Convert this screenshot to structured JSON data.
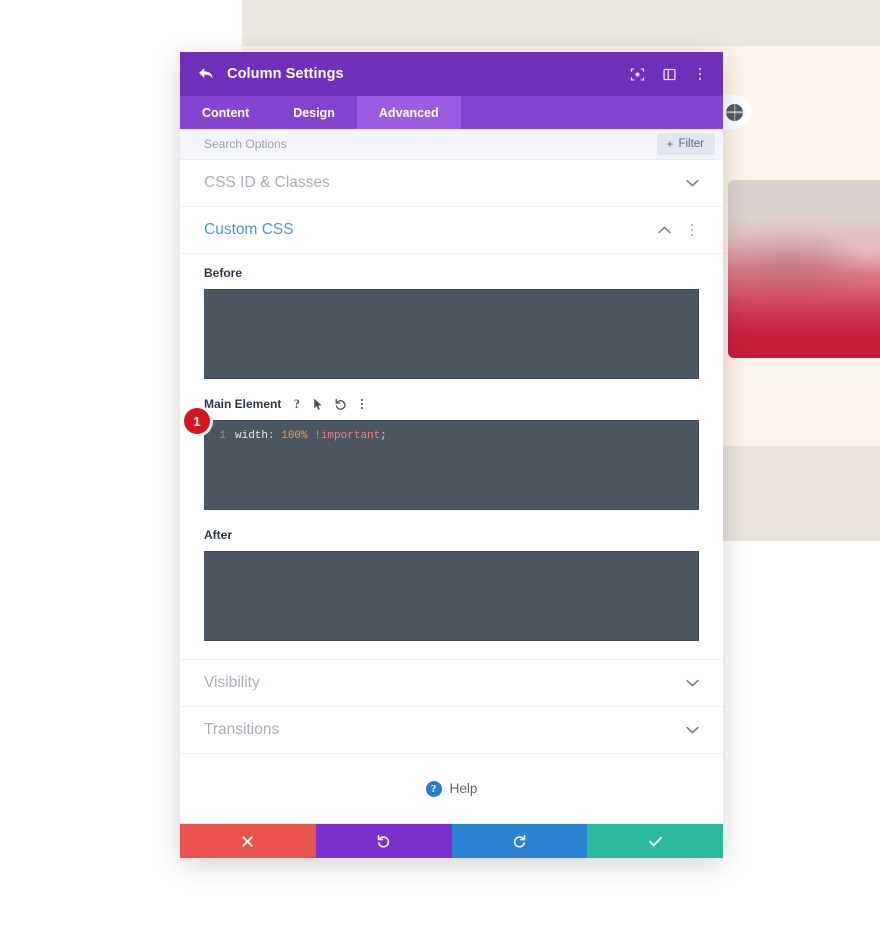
{
  "background": {
    "photo_alt": "aerial-landscape-red-gradient",
    "globe_icon": "globe-icon"
  },
  "modal": {
    "title": "Column Settings",
    "back_icon": "back-arrow-icon",
    "titlebar_icons": [
      {
        "name": "focus-target-icon"
      },
      {
        "name": "layout-panel-icon"
      },
      {
        "name": "more-options-icon"
      }
    ],
    "tabs": [
      {
        "label": "Content",
        "active": false
      },
      {
        "label": "Design",
        "active": false
      },
      {
        "label": "Advanced",
        "active": true
      }
    ],
    "search": {
      "placeholder": "Search Options",
      "value": ""
    },
    "filter": {
      "label": "Filter",
      "plus": "+"
    },
    "sections": [
      {
        "label": "CSS ID & Classes",
        "state": "collapsed",
        "chevron": "chevron-down-icon"
      },
      {
        "label": "Custom CSS",
        "state": "expanded",
        "chevron": "chevron-up-icon"
      },
      {
        "label": "Visibility",
        "state": "collapsed",
        "chevron": "chevron-down-icon"
      },
      {
        "label": "Transitions",
        "state": "collapsed",
        "chevron": "chevron-down-icon"
      }
    ],
    "custom_css": {
      "before": {
        "label": "Before",
        "value": ""
      },
      "main_element": {
        "label": "Main Element",
        "icons": [
          {
            "name": "help-question-icon",
            "glyph": "?"
          },
          {
            "name": "cursor-pointer-icon"
          },
          {
            "name": "reset-undo-icon"
          },
          {
            "name": "more-options-icon"
          }
        ],
        "line_number": "1",
        "code_tokens": [
          {
            "type": "prop",
            "text": "width"
          },
          {
            "type": "punc",
            "text": ": "
          },
          {
            "type": "num",
            "text": "100%"
          },
          {
            "type": "punc",
            "text": " "
          },
          {
            "type": "imp",
            "text": "!important"
          },
          {
            "type": "punc",
            "text": ";"
          }
        ],
        "code_plain": "width: 100% !important;"
      },
      "after": {
        "label": "After",
        "value": ""
      }
    },
    "step_badge": "1",
    "help": {
      "label": "Help",
      "icon": "help-circle-icon",
      "icon_glyph": "?"
    },
    "footer_buttons": [
      {
        "name": "discard-button",
        "icon": "close-x-icon",
        "color": "#e8544d"
      },
      {
        "name": "undo-button",
        "icon": "undo-icon",
        "color": "#7b2fcf"
      },
      {
        "name": "redo-button",
        "icon": "redo-icon",
        "color": "#2a84d3"
      },
      {
        "name": "save-button",
        "icon": "checkmark-icon",
        "color": "#2bb99b"
      }
    ]
  },
  "colors": {
    "titlebar_purple": "#6d30b8",
    "tabbar_purple": "#8345cf",
    "active_tab_purple": "#9a5ce0",
    "code_bg": "#4c5663",
    "badge_red": "#d6151f",
    "accent_blue": "#4f95c4"
  }
}
